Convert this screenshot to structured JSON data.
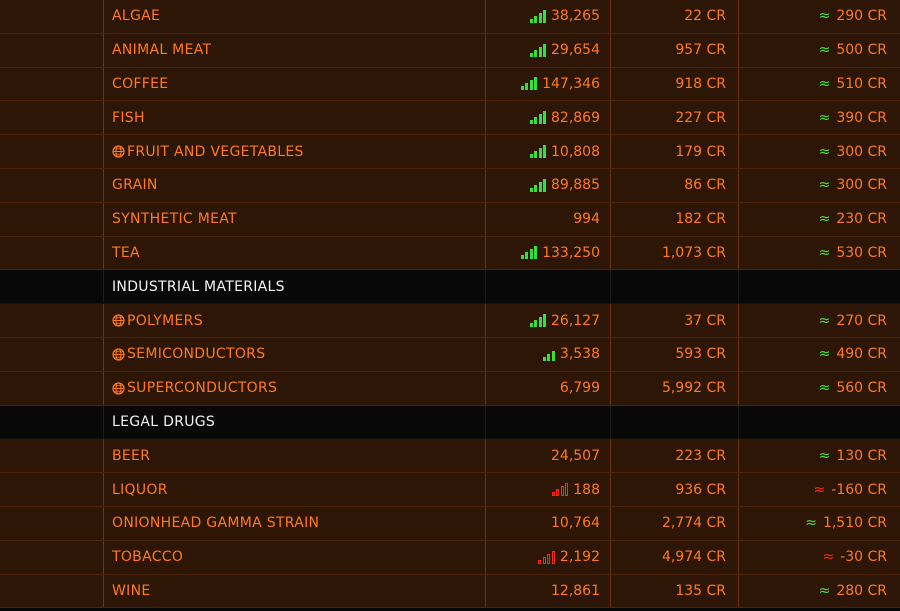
{
  "rows": [
    {
      "type": "item",
      "name": "ALGAE",
      "globe": false,
      "supply": "38,265",
      "indicator": "green",
      "price": "22 CR",
      "approx_color": "green",
      "avg": "290 CR"
    },
    {
      "type": "item",
      "name": "ANIMAL MEAT",
      "globe": false,
      "supply": "29,654",
      "indicator": "green",
      "price": "957 CR",
      "approx_color": "green",
      "avg": "500 CR"
    },
    {
      "type": "item",
      "name": "COFFEE",
      "globe": false,
      "supply": "147,346",
      "indicator": "green",
      "price": "918 CR",
      "approx_color": "green",
      "avg": "510 CR"
    },
    {
      "type": "item",
      "name": "FISH",
      "globe": false,
      "supply": "82,869",
      "indicator": "green",
      "price": "227 CR",
      "approx_color": "green",
      "avg": "390 CR"
    },
    {
      "type": "item",
      "name": "FRUIT AND VEGETABLES",
      "globe": true,
      "supply": "10,808",
      "indicator": "green",
      "price": "179 CR",
      "approx_color": "green",
      "avg": "300 CR"
    },
    {
      "type": "item",
      "name": "GRAIN",
      "globe": false,
      "supply": "89,885",
      "indicator": "green",
      "price": "86 CR",
      "approx_color": "green",
      "avg": "300 CR"
    },
    {
      "type": "item",
      "name": "SYNTHETIC MEAT",
      "globe": false,
      "supply": "994",
      "indicator": "none",
      "price": "182 CR",
      "approx_color": "green",
      "avg": "230 CR"
    },
    {
      "type": "item",
      "name": "TEA",
      "globe": false,
      "supply": "133,250",
      "indicator": "green",
      "price": "1,073 CR",
      "approx_color": "green",
      "avg": "530 CR"
    },
    {
      "type": "category",
      "name": "INDUSTRIAL MATERIALS"
    },
    {
      "type": "item",
      "name": "POLYMERS",
      "globe": true,
      "supply": "26,127",
      "indicator": "green",
      "price": "37 CR",
      "approx_color": "green",
      "avg": "270 CR"
    },
    {
      "type": "item",
      "name": "SEMICONDUCTORS",
      "globe": true,
      "supply": "3,538",
      "indicator": "green3",
      "price": "593 CR",
      "approx_color": "green",
      "avg": "490 CR"
    },
    {
      "type": "item",
      "name": "SUPERCONDUCTORS",
      "globe": true,
      "supply": "6,799",
      "indicator": "none",
      "price": "5,992 CR",
      "approx_color": "green",
      "avg": "560 CR"
    },
    {
      "type": "category",
      "name": "LEGAL DRUGS"
    },
    {
      "type": "item",
      "name": "BEER",
      "globe": false,
      "supply": "24,507",
      "indicator": "none",
      "price": "223 CR",
      "approx_color": "green",
      "avg": "130 CR"
    },
    {
      "type": "item",
      "name": "LIQUOR",
      "globe": false,
      "supply": "188",
      "indicator": "red",
      "price": "936 CR",
      "approx_color": "red",
      "avg": "-160 CR"
    },
    {
      "type": "item",
      "name": "ONIONHEAD GAMMA STRAIN",
      "globe": false,
      "supply": "10,764",
      "indicator": "none",
      "price": "2,774 CR",
      "approx_color": "green",
      "avg": "1,510 CR"
    },
    {
      "type": "item",
      "name": "TOBACCO",
      "globe": false,
      "supply": "2,192",
      "indicator": "red",
      "price": "4,974 CR",
      "approx_color": "red",
      "avg": "-30 CR"
    },
    {
      "type": "item",
      "name": "WINE",
      "globe": false,
      "supply": "12,861",
      "indicator": "none",
      "price": "135 CR",
      "approx_color": "green",
      "avg": "280 CR"
    }
  ],
  "symbols": {
    "approx": "≈"
  },
  "colors": {
    "row_bg": "#2e1606",
    "text_orange": "#ff7a1a",
    "green": "#36e03a",
    "red": "#ff2a1a",
    "category_bg": "#080808"
  }
}
